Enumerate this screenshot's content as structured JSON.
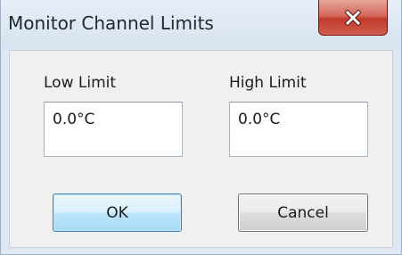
{
  "window": {
    "title": "Monitor Channel Limits"
  },
  "close_icon": "close-icon",
  "low_limit": {
    "label": "Low Limit",
    "value": "0.0°C"
  },
  "high_limit": {
    "label": "High Limit",
    "value": "0.0°C"
  },
  "buttons": {
    "ok_label": "OK",
    "cancel_label": "Cancel"
  },
  "colors": {
    "close_button": "#c0392b",
    "ok_border": "#3c7fb1",
    "window_frame": "#dfe8f2"
  }
}
